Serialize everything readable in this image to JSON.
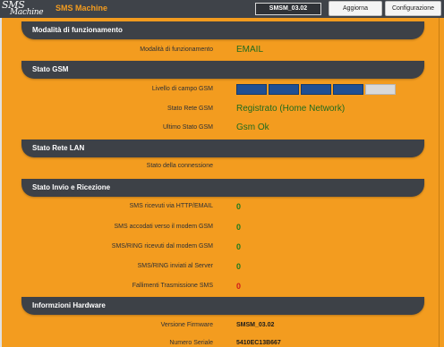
{
  "header": {
    "logo_line1": "SMS",
    "logo_line2": "Machine",
    "app_title": "SMS Machine",
    "device_name": "SMSM_03.02",
    "refresh_label": "Aggiorna",
    "config_label": "Configurazione"
  },
  "sections": {
    "mode": {
      "title": "Modalità di funzionamento",
      "label": "Modalità di funzionamento",
      "value": "EMAIL"
    },
    "gsm": {
      "title": "Stato GSM",
      "signal_label": "Livello di campo GSM",
      "signal_level": 4,
      "signal_max": 5,
      "network_label": "Stato Rete GSM",
      "network_value": "Registrato (Home Network)",
      "last_label": "Ultimo Stato GSM",
      "last_value": "Gsm Ok"
    },
    "lan": {
      "title": "Stato Rete LAN",
      "conn_label": "Stato della connessione",
      "conn_value": ""
    },
    "io": {
      "title": "Stato Invio e Ricezione",
      "rows": [
        {
          "label": "SMS ricevuti via HTTP/EMAIL",
          "value": "0"
        },
        {
          "label": "SMS accodati verso il modem GSM",
          "value": "0"
        },
        {
          "label": "SMS/RING ricevuti dal modem GSM",
          "value": "0"
        },
        {
          "label": "SMS/RING inviati al Server",
          "value": "0"
        },
        {
          "label": "Fallimenti Trasmissione SMS",
          "value": "0"
        }
      ]
    },
    "hw": {
      "title": "Informzioni Hardware",
      "firmware_label": "Versione Firmware",
      "firmware_value": "SMSM_03.02",
      "serial_label": "Numero Seriale",
      "serial_value": "5410EC13B667"
    }
  },
  "colors": {
    "background": "#f39c1f",
    "header_bg": "#3d4147",
    "ok_green": "#1e6b1e",
    "error_red": "#d11a1a",
    "signal_on": "#1f4f93",
    "signal_off": "#d9d9d9"
  }
}
